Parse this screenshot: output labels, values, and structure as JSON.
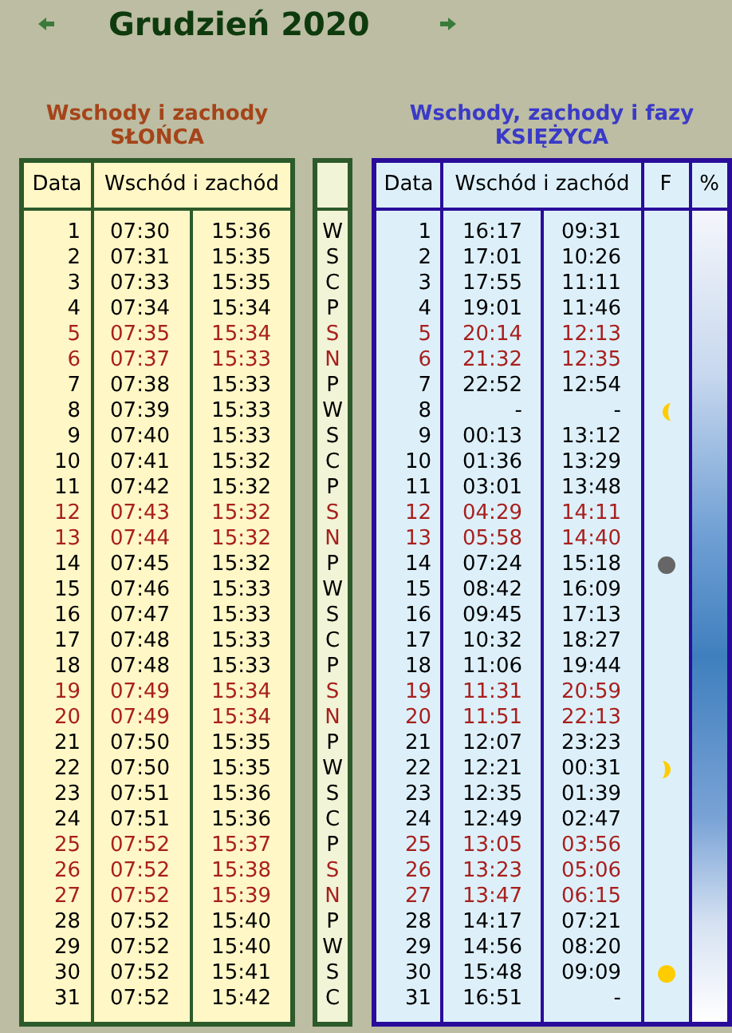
{
  "title": "Grudzień 2020",
  "sun": {
    "heading": "Wschody i zachody",
    "subheading": "SŁOŃCA",
    "columns": [
      "Data",
      "Wschód i zachód"
    ],
    "rows": [
      {
        "day": "1",
        "rise": "07:30",
        "set": "15:36",
        "holiday": false
      },
      {
        "day": "2",
        "rise": "07:31",
        "set": "15:35",
        "holiday": false
      },
      {
        "day": "3",
        "rise": "07:33",
        "set": "15:35",
        "holiday": false
      },
      {
        "day": "4",
        "rise": "07:34",
        "set": "15:34",
        "holiday": false
      },
      {
        "day": "5",
        "rise": "07:35",
        "set": "15:34",
        "holiday": true
      },
      {
        "day": "6",
        "rise": "07:37",
        "set": "15:33",
        "holiday": true
      },
      {
        "day": "7",
        "rise": "07:38",
        "set": "15:33",
        "holiday": false
      },
      {
        "day": "8",
        "rise": "07:39",
        "set": "15:33",
        "holiday": false
      },
      {
        "day": "9",
        "rise": "07:40",
        "set": "15:33",
        "holiday": false
      },
      {
        "day": "10",
        "rise": "07:41",
        "set": "15:32",
        "holiday": false
      },
      {
        "day": "11",
        "rise": "07:42",
        "set": "15:32",
        "holiday": false
      },
      {
        "day": "12",
        "rise": "07:43",
        "set": "15:32",
        "holiday": true
      },
      {
        "day": "13",
        "rise": "07:44",
        "set": "15:32",
        "holiday": true
      },
      {
        "day": "14",
        "rise": "07:45",
        "set": "15:32",
        "holiday": false
      },
      {
        "day": "15",
        "rise": "07:46",
        "set": "15:33",
        "holiday": false
      },
      {
        "day": "16",
        "rise": "07:47",
        "set": "15:33",
        "holiday": false
      },
      {
        "day": "17",
        "rise": "07:48",
        "set": "15:33",
        "holiday": false
      },
      {
        "day": "18",
        "rise": "07:48",
        "set": "15:33",
        "holiday": false
      },
      {
        "day": "19",
        "rise": "07:49",
        "set": "15:34",
        "holiday": true
      },
      {
        "day": "20",
        "rise": "07:49",
        "set": "15:34",
        "holiday": true
      },
      {
        "day": "21",
        "rise": "07:50",
        "set": "15:35",
        "holiday": false
      },
      {
        "day": "22",
        "rise": "07:50",
        "set": "15:35",
        "holiday": false
      },
      {
        "day": "23",
        "rise": "07:51",
        "set": "15:36",
        "holiday": false
      },
      {
        "day": "24",
        "rise": "07:51",
        "set": "15:36",
        "holiday": false
      },
      {
        "day": "25",
        "rise": "07:52",
        "set": "15:37",
        "holiday": true
      },
      {
        "day": "26",
        "rise": "07:52",
        "set": "15:38",
        "holiday": true
      },
      {
        "day": "27",
        "rise": "07:52",
        "set": "15:39",
        "holiday": true
      },
      {
        "day": "28",
        "rise": "07:52",
        "set": "15:40",
        "holiday": false
      },
      {
        "day": "29",
        "rise": "07:52",
        "set": "15:40",
        "holiday": false
      },
      {
        "day": "30",
        "rise": "07:52",
        "set": "15:41",
        "holiday": false
      },
      {
        "day": "31",
        "rise": "07:52",
        "set": "15:42",
        "holiday": false
      }
    ]
  },
  "weekdays": [
    {
      "letter": "W",
      "holiday": false
    },
    {
      "letter": "S",
      "holiday": false
    },
    {
      "letter": "C",
      "holiday": false
    },
    {
      "letter": "P",
      "holiday": false
    },
    {
      "letter": "S",
      "holiday": true
    },
    {
      "letter": "N",
      "holiday": true
    },
    {
      "letter": "P",
      "holiday": false
    },
    {
      "letter": "W",
      "holiday": false
    },
    {
      "letter": "S",
      "holiday": false
    },
    {
      "letter": "C",
      "holiday": false
    },
    {
      "letter": "P",
      "holiday": false
    },
    {
      "letter": "S",
      "holiday": true
    },
    {
      "letter": "N",
      "holiday": true
    },
    {
      "letter": "P",
      "holiday": false
    },
    {
      "letter": "W",
      "holiday": false
    },
    {
      "letter": "S",
      "holiday": false
    },
    {
      "letter": "C",
      "holiday": false
    },
    {
      "letter": "P",
      "holiday": false
    },
    {
      "letter": "S",
      "holiday": true
    },
    {
      "letter": "N",
      "holiday": true
    },
    {
      "letter": "P",
      "holiday": false
    },
    {
      "letter": "W",
      "holiday": false
    },
    {
      "letter": "S",
      "holiday": false
    },
    {
      "letter": "C",
      "holiday": false
    },
    {
      "letter": "P",
      "holiday": false
    },
    {
      "letter": "S",
      "holiday": true
    },
    {
      "letter": "N",
      "holiday": true
    },
    {
      "letter": "P",
      "holiday": false
    },
    {
      "letter": "W",
      "holiday": false
    },
    {
      "letter": "S",
      "holiday": false
    },
    {
      "letter": "C",
      "holiday": false
    }
  ],
  "moon": {
    "heading": "Wschody, zachody i fazy",
    "subheading": "KSIĘŻYCA",
    "columns": [
      "Data",
      "Wschód i zachód",
      "F",
      "%"
    ],
    "rows": [
      {
        "day": "1",
        "rise": "16:17",
        "set": "09:31",
        "holiday": false
      },
      {
        "day": "2",
        "rise": "17:01",
        "set": "10:26",
        "holiday": false
      },
      {
        "day": "3",
        "rise": "17:55",
        "set": "11:11",
        "holiday": false
      },
      {
        "day": "4",
        "rise": "19:01",
        "set": "11:46",
        "holiday": false
      },
      {
        "day": "5",
        "rise": "20:14",
        "set": "12:13",
        "holiday": true
      },
      {
        "day": "6",
        "rise": "21:32",
        "set": "12:35",
        "holiday": true
      },
      {
        "day": "7",
        "rise": "22:52",
        "set": "12:54",
        "holiday": false
      },
      {
        "day": "8",
        "rise": "-",
        "set": "-",
        "holiday": false,
        "kind": "lastquarter"
      },
      {
        "day": "9",
        "rise": "00:13",
        "set": "13:12",
        "holiday": false
      },
      {
        "day": "10",
        "rise": "01:36",
        "set": "13:29",
        "holiday": false
      },
      {
        "day": "11",
        "rise": "03:01",
        "set": "13:48",
        "holiday": false
      },
      {
        "day": "12",
        "rise": "04:29",
        "set": "14:11",
        "holiday": true
      },
      {
        "day": "13",
        "rise": "05:58",
        "set": "14:40",
        "holiday": true
      },
      {
        "day": "14",
        "rise": "07:24",
        "set": "15:18",
        "holiday": false,
        "kind": "newmoon"
      },
      {
        "day": "15",
        "rise": "08:42",
        "set": "16:09",
        "holiday": false
      },
      {
        "day": "16",
        "rise": "09:45",
        "set": "17:13",
        "holiday": false
      },
      {
        "day": "17",
        "rise": "10:32",
        "set": "18:27",
        "holiday": false
      },
      {
        "day": "18",
        "rise": "11:06",
        "set": "19:44",
        "holiday": false
      },
      {
        "day": "19",
        "rise": "11:31",
        "set": "20:59",
        "holiday": true
      },
      {
        "day": "20",
        "rise": "11:51",
        "set": "22:13",
        "holiday": true
      },
      {
        "day": "21",
        "rise": "12:07",
        "set": "23:23",
        "holiday": false
      },
      {
        "day": "22",
        "rise": "12:21",
        "set": "00:31",
        "holiday": false,
        "kind": "firstquarter"
      },
      {
        "day": "23",
        "rise": "12:35",
        "set": "01:39",
        "holiday": false
      },
      {
        "day": "24",
        "rise": "12:49",
        "set": "02:47",
        "holiday": false
      },
      {
        "day": "25",
        "rise": "13:05",
        "set": "03:56",
        "holiday": true
      },
      {
        "day": "26",
        "rise": "13:23",
        "set": "05:06",
        "holiday": true
      },
      {
        "day": "27",
        "rise": "13:47",
        "set": "06:15",
        "holiday": true
      },
      {
        "day": "28",
        "rise": "14:17",
        "set": "07:21",
        "holiday": false
      },
      {
        "day": "29",
        "rise": "14:56",
        "set": "08:20",
        "holiday": false
      },
      {
        "day": "30",
        "rise": "15:48",
        "set": "09:09",
        "holiday": false,
        "kind": "fullmoon"
      },
      {
        "day": "31",
        "rise": "16:51",
        "set": "-",
        "holiday": false
      }
    ]
  }
}
